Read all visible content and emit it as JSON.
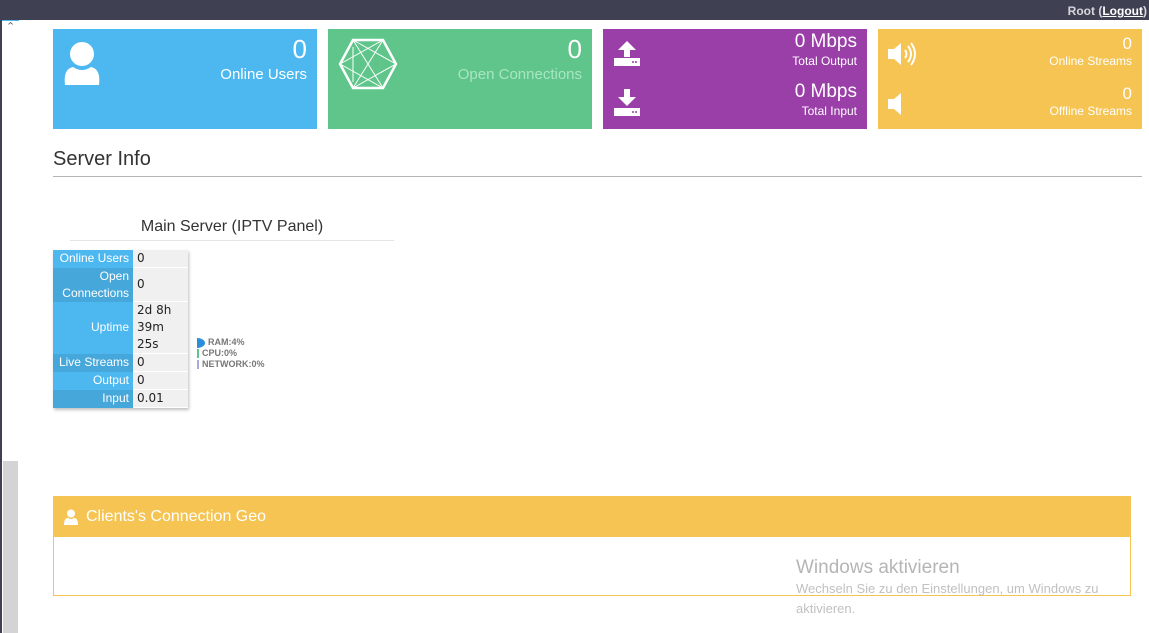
{
  "topbar": {
    "user": "Root",
    "logout_label": "Logout"
  },
  "tiles": {
    "online_users": {
      "value": "0",
      "label": "Online Users",
      "icon": "user-icon",
      "color": "#4db8f0"
    },
    "open_connections": {
      "value": "0",
      "label": "Open Connections",
      "icon": "network-icon",
      "color": "#60c58a"
    },
    "bandwidth": {
      "color": "#9a3ea8",
      "output": {
        "value": "0 Mbps",
        "label": "Total Output",
        "icon": "upload-icon"
      },
      "input": {
        "value": "0 Mbps",
        "label": "Total Input",
        "icon": "download-icon"
      }
    },
    "streams": {
      "color": "#f5c452",
      "online": {
        "value": "0",
        "label": "Online Streams",
        "icon": "volume-up-icon"
      },
      "offline": {
        "value": "0",
        "label": "Offline Streams",
        "icon": "volume-off-icon"
      }
    }
  },
  "server_info": {
    "title": "Server Info",
    "server_name": "Main Server (IPTV Panel)",
    "stats": [
      {
        "key": "Online Users",
        "value": "0"
      },
      {
        "key": "Open Connections",
        "value": "0"
      },
      {
        "key": "Uptime",
        "value": "2d 8h 39m 25s"
      },
      {
        "key": "Live Streams",
        "value": "0"
      },
      {
        "key": "Output",
        "value": "0"
      },
      {
        "key": "Input",
        "value": "0.01"
      }
    ],
    "usage": [
      {
        "label": "RAM:4%",
        "percent": 4,
        "color": "#2a8fd8"
      },
      {
        "label": "CPU:0%",
        "percent": 0,
        "color": "#5cc48a"
      },
      {
        "label": "NETWORK:0%",
        "percent": 0,
        "color": "#a9a9dc"
      }
    ]
  },
  "geo": {
    "title": "Clients's Connection Geo"
  },
  "watermark": {
    "title": "Windows aktivieren",
    "subtitle": "Wechseln Sie zu den Einstellungen, um Windows zu aktivieren."
  }
}
